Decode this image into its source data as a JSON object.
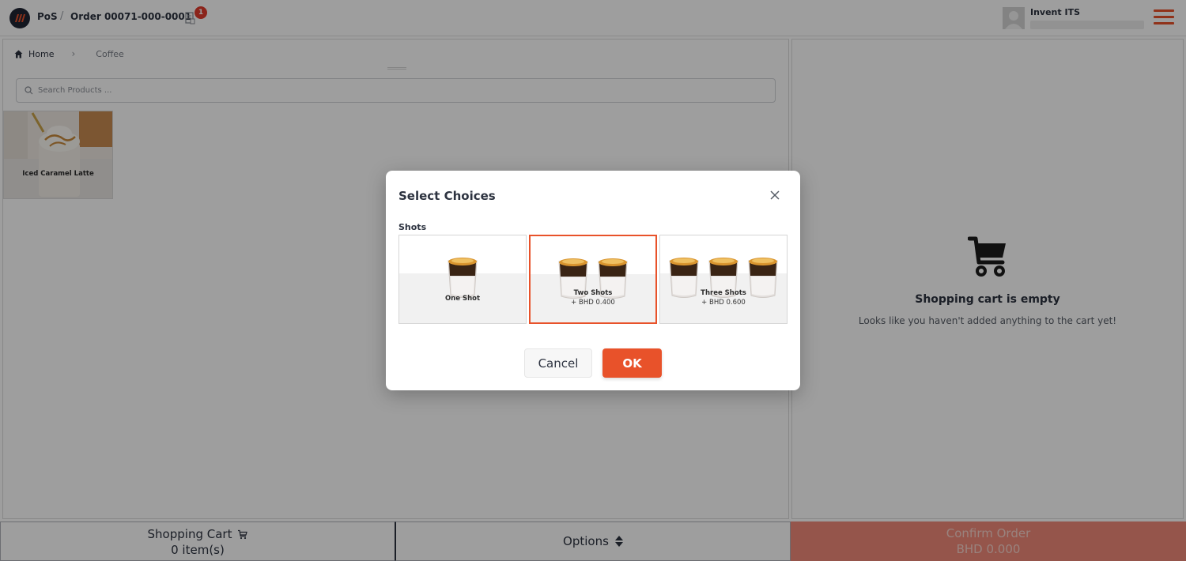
{
  "header": {
    "app_label": "PoS",
    "separator": "/",
    "order_label": "Order 00071-000-0001",
    "notification_count": "1",
    "user_name": "Invent ITS"
  },
  "breadcrumb": {
    "home": "Home",
    "current": "Coffee"
  },
  "search": {
    "placeholder": "Search Products ..."
  },
  "products": [
    {
      "name": "Iced Caramel Latte"
    }
  ],
  "cart": {
    "empty_title": "Shopping cart is empty",
    "empty_message": "Looks like you haven't added anything to the cart yet!"
  },
  "bottom_bar": {
    "cart_label": "Shopping Cart",
    "cart_count": "0 item(s)",
    "options_label": "Options",
    "confirm_label": "Confirm Order",
    "confirm_total": "BHD 0.000"
  },
  "modal": {
    "title": "Select Choices",
    "group_label": "Shots",
    "choices": [
      {
        "label": "One Shot",
        "price": "",
        "cups": 1,
        "selected": false
      },
      {
        "label": "Two Shots",
        "price": "+ BHD 0.400",
        "cups": 2,
        "selected": true
      },
      {
        "label": "Three Shots",
        "price": "+ BHD 0.600",
        "cups": 3,
        "selected": false
      }
    ],
    "cancel_label": "Cancel",
    "ok_label": "OK"
  },
  "colors": {
    "accent": "#e8522a",
    "badge": "#e03a2c",
    "dark_text": "#2d3340"
  }
}
